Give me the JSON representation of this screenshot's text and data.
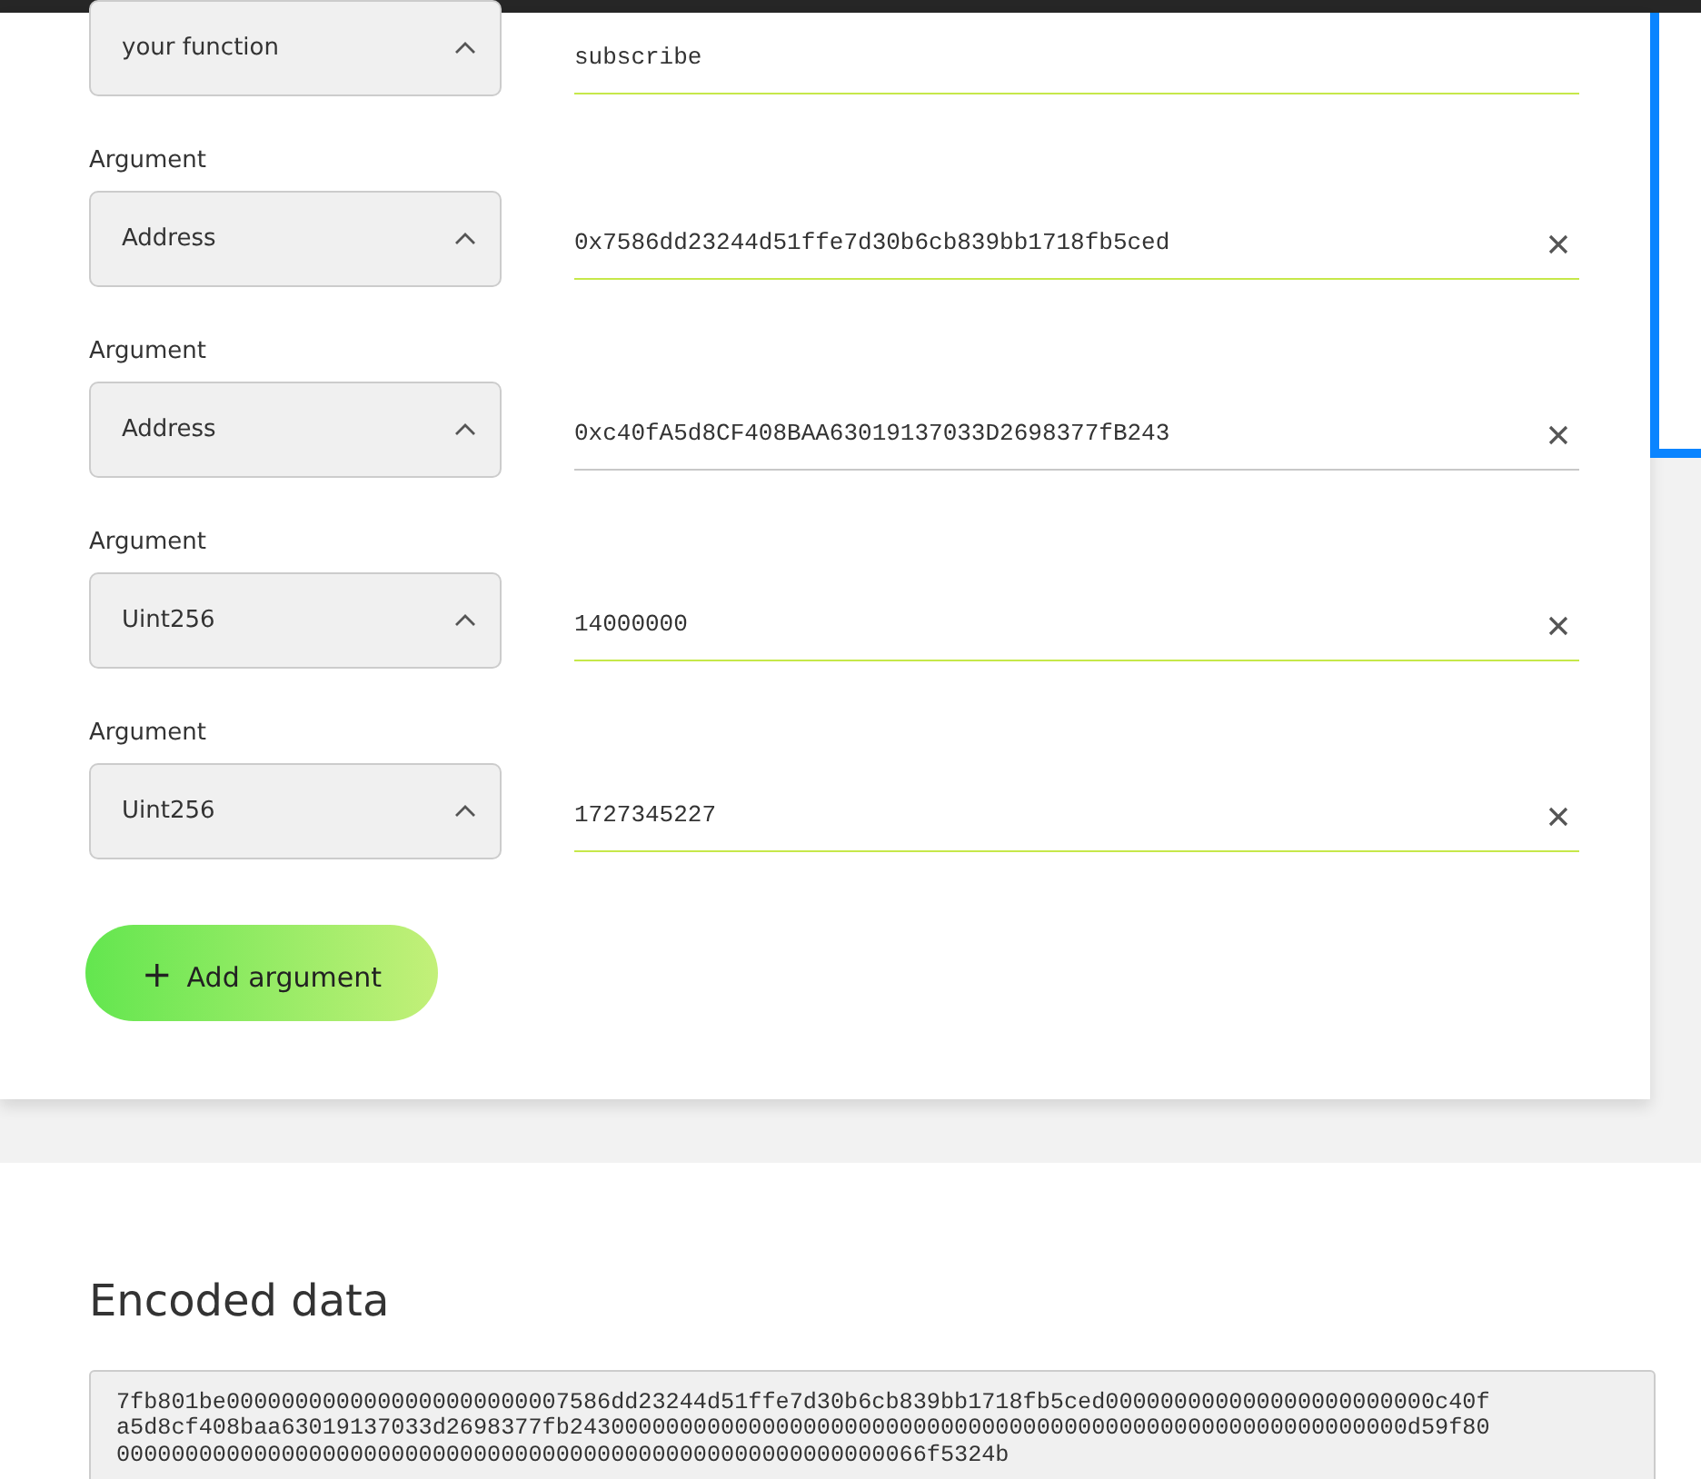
{
  "function_row": {
    "type": "your function",
    "value": "subscribe",
    "valid": true
  },
  "arguments": [
    {
      "label": "Argument",
      "type": "Address",
      "value": "0x7586dd23244d51ffe7d30b6cb839bb1718fb5ced",
      "valid": true,
      "clearable": true
    },
    {
      "label": "Argument",
      "type": "Address",
      "value": "0xc40fA5d8CF408BAA63019137033D2698377fB243",
      "valid": false,
      "clearable": true
    },
    {
      "label": "Argument",
      "type": "Uint256",
      "value": "14000000",
      "valid": true,
      "clearable": true
    },
    {
      "label": "Argument",
      "type": "Uint256",
      "value": "1727345227",
      "valid": true,
      "clearable": true
    }
  ],
  "add_button": {
    "icon": "+",
    "label": "Add argument"
  },
  "encoded": {
    "title": "Encoded data",
    "value": "7fb801be0000000000000000000000007586dd23244d51ffe7d30b6cb839bb1718fb5ced000000000000000000000000c40fa5d8cf408baa63019137033d2698377fb2430000000000000000000000000000000000000000000000000000000000d59f8000000000000000000000000000000000000000000000000000000000066f5324b"
  }
}
